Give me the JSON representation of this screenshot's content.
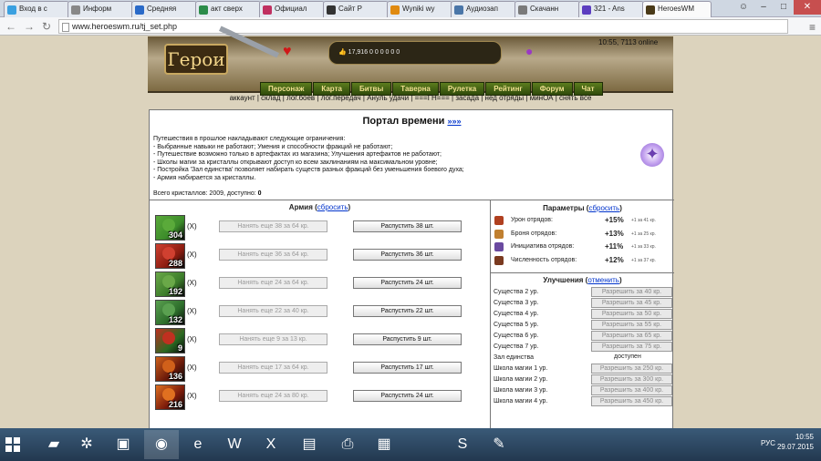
{
  "browser": {
    "tabs": [
      {
        "label": "Вход в с",
        "color": "#3aa0e0"
      },
      {
        "label": "Информ",
        "color": "#888"
      },
      {
        "label": "Средняя",
        "color": "#2a6ac8"
      },
      {
        "label": "акт сверх",
        "color": "#2c8c4a"
      },
      {
        "label": "Официал",
        "color": "#c03060"
      },
      {
        "label": "Сайт Р",
        "color": "#333"
      },
      {
        "label": "Wyniki wy",
        "color": "#e08a10"
      },
      {
        "label": "Аудиозап",
        "color": "#4a76a8"
      },
      {
        "label": "Скачанн",
        "color": "#7a7a7a"
      },
      {
        "label": "321 - Ans",
        "color": "#5c3ec0"
      },
      {
        "label": "HeroesWM",
        "color": "#4a3a18"
      }
    ],
    "url": "www.heroeswm.ru/tj_set.php"
  },
  "game": {
    "logo": "Герои",
    "resources": "17,916  0  0  0  0  0  0",
    "clock": "10:55, 7113 online",
    "nav": [
      "Персонаж",
      "Карта",
      "Битвы",
      "Таверна",
      "Рулетка",
      "Рейтинг",
      "Форум",
      "Чат"
    ],
    "sublinks": "аккаунт | склад | лог.боев | лог.передач | Ануль удачи | ===ГН=== | засада | нед отряды | минОА | снять все"
  },
  "portal": {
    "title": "Портал времени",
    "more": "»»»",
    "info": [
      "Путешествия в прошлое накладывают следующие ограничения:",
      "- Выбранные навыки не работают; Умения и способности фракций не работают;",
      "- Путешествие возможно только в артефактах из магазина; Улучшения артефактов не работают;",
      "- Школы магии за кристаллы открывают доступ ко всем заклинаниям на максимальном уровне;",
      "- Постройка 'Зал единства' позволяет набирать существ разных фракций без уменьшения боевого духа;",
      "- Армия набирается за кристаллы."
    ],
    "crystals_label": "Всего кристаллов: 2009, доступно:",
    "crystals_available": "0"
  },
  "army": {
    "title": "Армия",
    "reset": "сбросить",
    "del": "(X)",
    "rows": [
      {
        "count": "304",
        "hire": "Нанять еще 38 за 64 кр.",
        "release": "Распустить 38 шт.",
        "color": "#3c8c2a",
        "head": "#5aaa3a"
      },
      {
        "count": "288",
        "hire": "Нанять еще 36 за 64 кр.",
        "release": "Распустить 36 шт.",
        "color": "#8c1c10",
        "head": "#d04030"
      },
      {
        "count": "192",
        "hire": "Нанять еще 24 за 64 кр.",
        "release": "Распустить 24 шт.",
        "color": "#3c7c2a",
        "head": "#6aa848"
      },
      {
        "count": "132",
        "hire": "Нанять еще 22 за 40 кр.",
        "release": "Распустить 22 шт.",
        "color": "#2c6c2a",
        "head": "#5aa050"
      },
      {
        "count": "9",
        "hire": "Нанять еще 9 за 13 кр.",
        "release": "Распустить 9 шт.",
        "color": "#2a6a22",
        "head": "#c03020"
      },
      {
        "count": "136",
        "hire": "Нанять еще 17 за 64 кр.",
        "release": "Распустить 17 шт.",
        "color": "#6a1a0a",
        "head": "#d0601a"
      },
      {
        "count": "216",
        "hire": "Нанять еще 24 за 80 кр.",
        "release": "Распустить 24 шт.",
        "color": "#7a1a0a",
        "head": "#e07020"
      }
    ]
  },
  "params": {
    "title": "Параметры",
    "reset": "сбросить",
    "rows": [
      {
        "label": "Урон отрядов:",
        "value": "+15%",
        "note": "+1 за 41 кр.",
        "color": "#b04020"
      },
      {
        "label": "Броня отрядов:",
        "value": "+13%",
        "note": "+1 за 25 кр.",
        "color": "#c08030"
      },
      {
        "label": "Инициатива отрядов:",
        "value": "+11%",
        "note": "+1 за 33 кр.",
        "color": "#6a4aa0"
      },
      {
        "label": "Численность отрядов:",
        "value": "+12%",
        "note": "+1 за 37 кр.",
        "color": "#7a3a20"
      }
    ]
  },
  "upgrades": {
    "title": "Улучшения",
    "cancel": "отменить",
    "rows": [
      {
        "label": "Существа 2 ур.",
        "btn": "Разрешить за 40 кр."
      },
      {
        "label": "Существа 3 ур.",
        "btn": "Разрешить за 45 кр."
      },
      {
        "label": "Существа 4 ур.",
        "btn": "Разрешить за 50 кр."
      },
      {
        "label": "Существа 5 ур.",
        "btn": "Разрешить за 55 кр."
      },
      {
        "label": "Существа 6 ур.",
        "btn": "Разрешить за 65 кр."
      },
      {
        "label": "Существа 7 ур.",
        "btn": "Разрешить за 75 кр."
      },
      {
        "label": "Зал единства",
        "status": "доступен"
      },
      {
        "label": "Школа магии 1 ур.",
        "btn": "Разрешить за 250 кр."
      },
      {
        "label": "Школа магии 2 ур.",
        "btn": "Разрешить за 300 кр."
      },
      {
        "label": "Школа магии 3 ур.",
        "btn": "Разрешить за 400 кр."
      },
      {
        "label": "Школа магии 4 ур.",
        "btn": "Разрешить за 450 кр."
      }
    ]
  },
  "taskbar": {
    "lang": "РУС",
    "time": "10:55",
    "date": "29.07.2015",
    "apps": [
      {
        "name": "file-explorer-icon",
        "glyph": "▰"
      },
      {
        "name": "settings-icon",
        "glyph": "✲"
      },
      {
        "name": "computer-icon",
        "glyph": "▣"
      },
      {
        "name": "chrome-icon",
        "glyph": "◉"
      },
      {
        "name": "ie-icon",
        "glyph": "e"
      },
      {
        "name": "word-icon",
        "glyph": "W"
      },
      {
        "name": "excel-icon",
        "glyph": "X"
      },
      {
        "name": "document-icon",
        "glyph": "▤"
      },
      {
        "name": "printer-icon",
        "glyph": "⎙"
      },
      {
        "name": "photos-icon",
        "glyph": "▦"
      },
      {
        "name": "skype-icon",
        "glyph": "S"
      },
      {
        "name": "paint-icon",
        "glyph": "✎"
      }
    ]
  }
}
